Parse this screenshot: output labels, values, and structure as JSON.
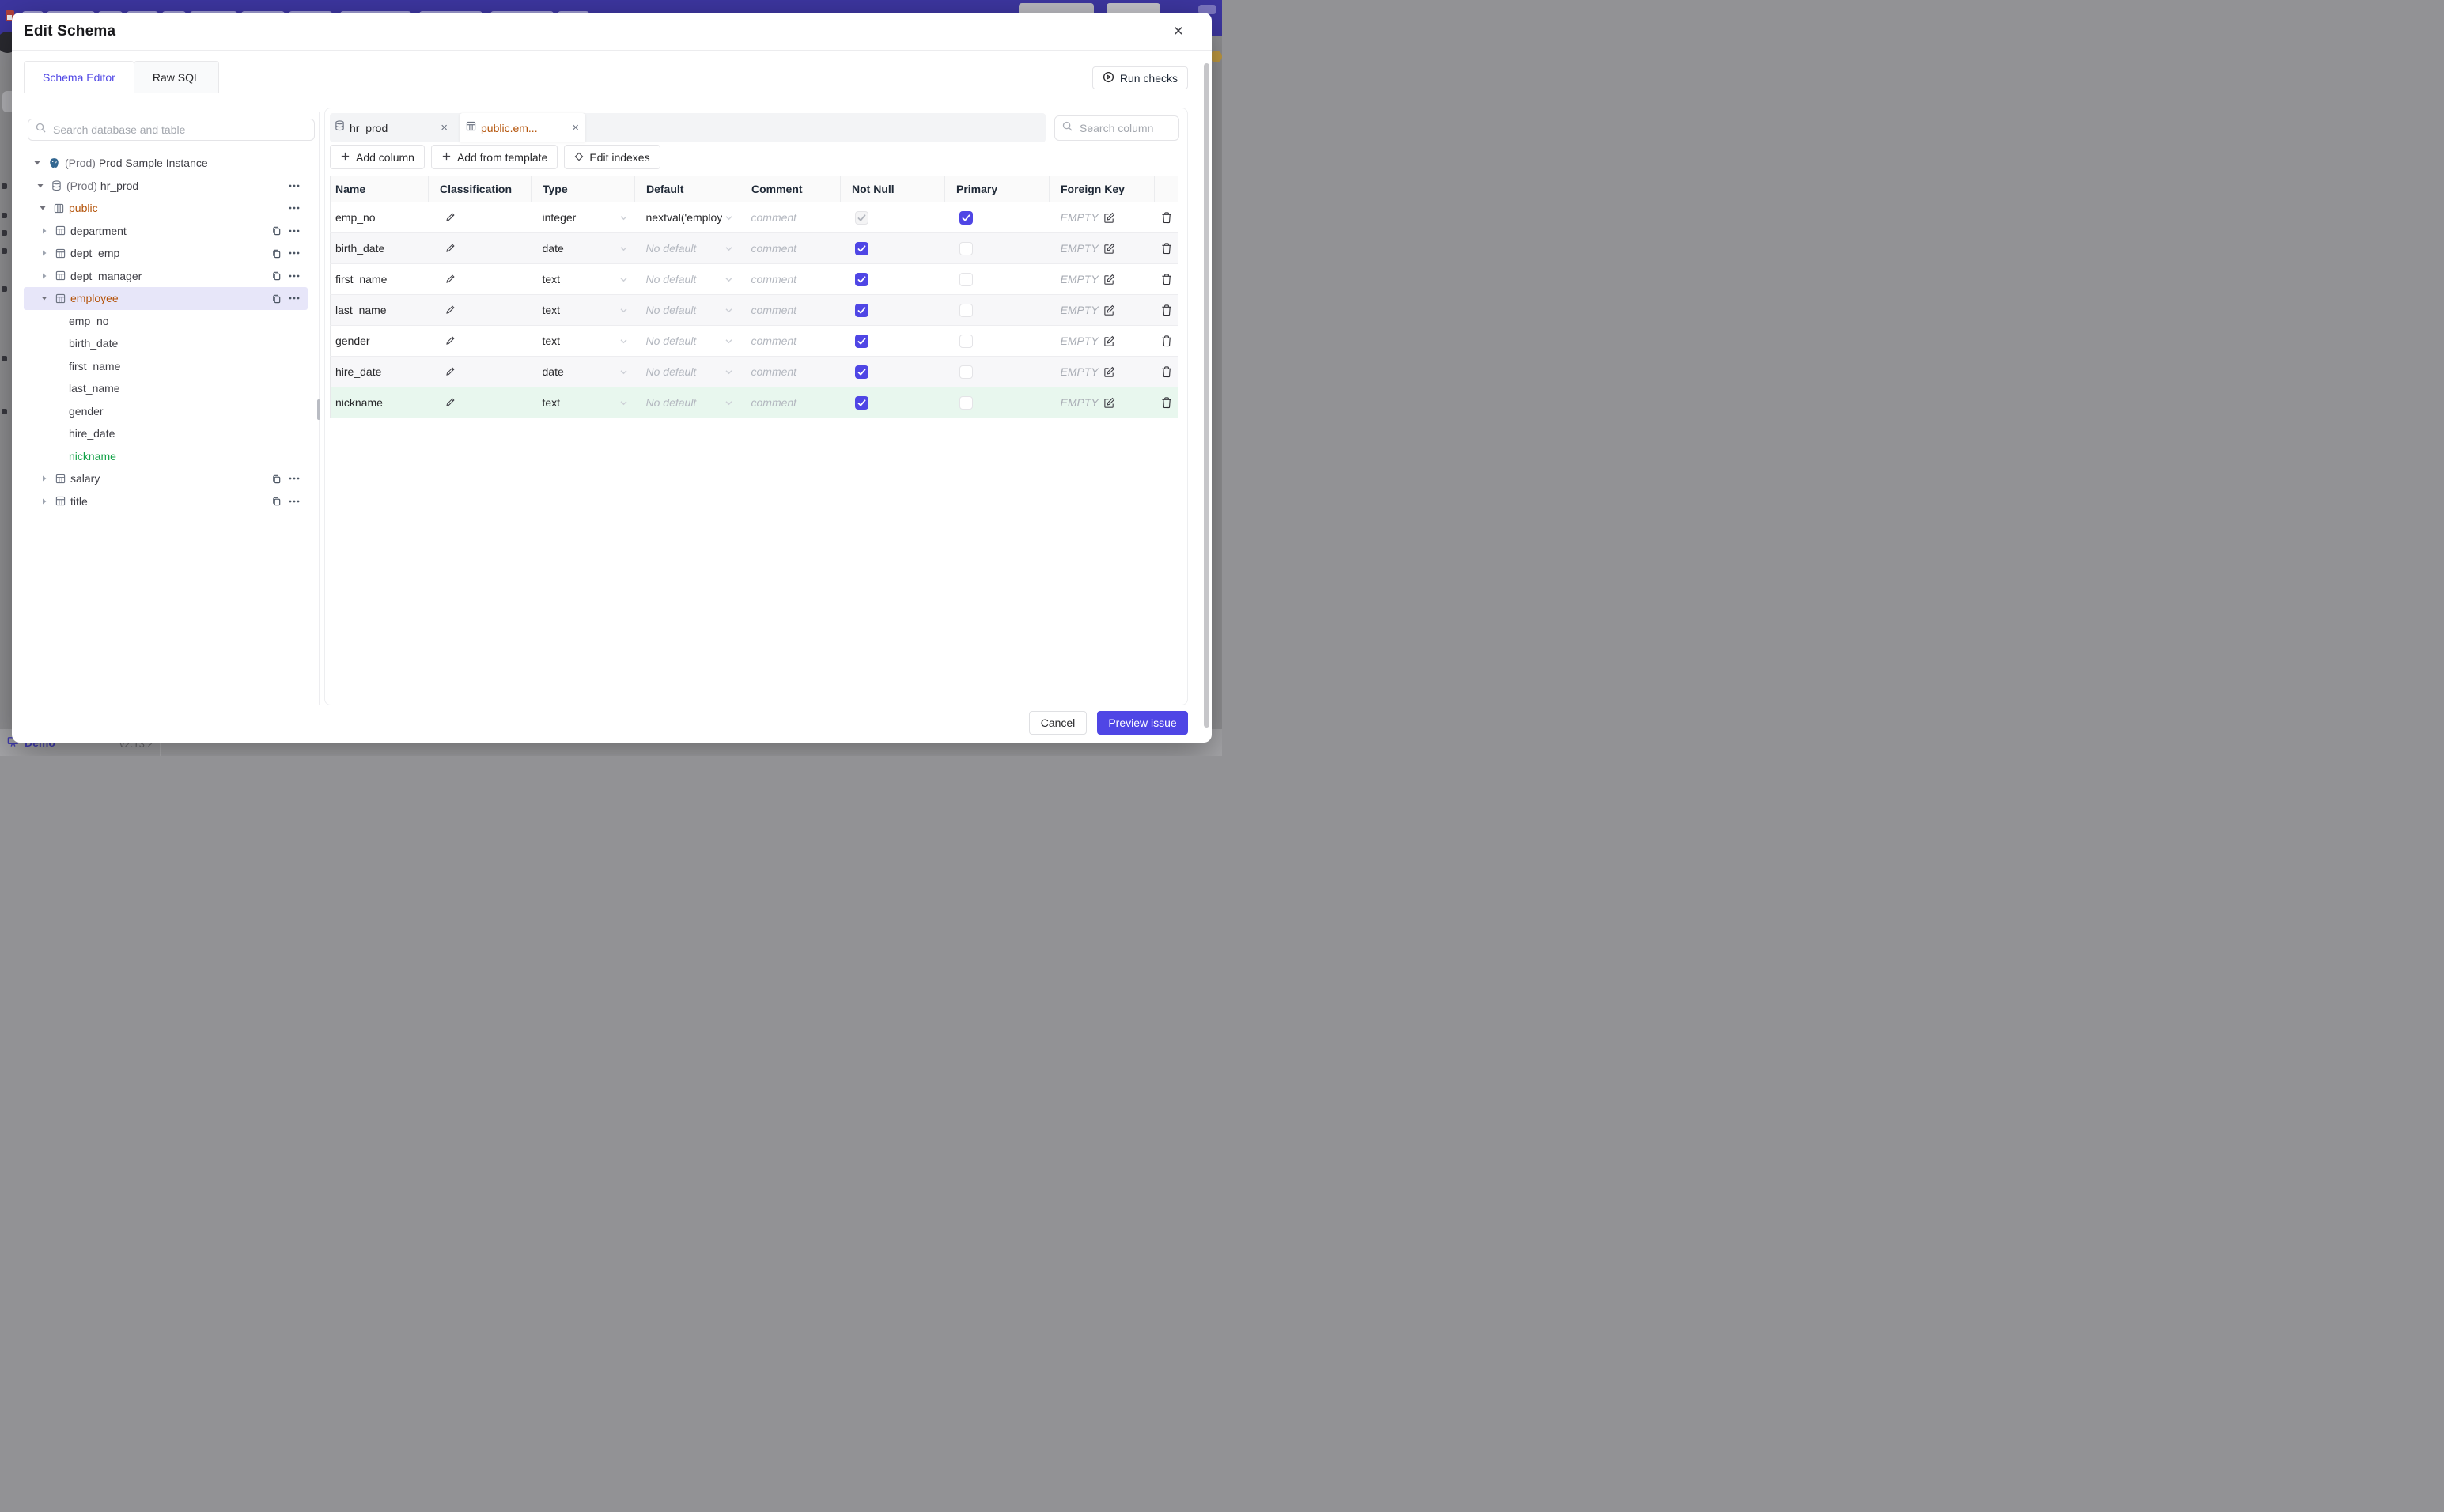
{
  "colors": {
    "accent": "#4f46e5",
    "topbar_purple": "#3d36a0",
    "schema_amber": "#b45309",
    "new_column_green": "#16a34a",
    "selected_row_lavender": "#e7e6f9",
    "new_row_green_bg": "#e8f7ee"
  },
  "backdrop": {
    "demo_label": "Demo",
    "version": "v2.13.2"
  },
  "modal": {
    "title": "Edit Schema",
    "close_icon": "×",
    "nav_tabs": [
      {
        "label": "Schema Editor",
        "active": true
      },
      {
        "label": "Raw SQL",
        "active": false
      }
    ],
    "run_checks_label": "Run checks",
    "sidebar": {
      "search_placeholder": "Search database and table",
      "tree": [
        {
          "level": 0,
          "caret": "down",
          "icon": "postgres",
          "prefix": "(Prod)",
          "label": "Prod Sample Instance",
          "actions": []
        },
        {
          "level": 1,
          "caret": "down",
          "icon": "database",
          "prefix": "(Prod)",
          "label": "hr_prod",
          "actions": [
            "more"
          ]
        },
        {
          "level": 2,
          "caret": "down",
          "icon": "schema",
          "label": "public",
          "style": "amber",
          "actions": [
            "more"
          ]
        },
        {
          "level": 3,
          "caret": "right",
          "icon": "table",
          "label": "department",
          "actions": [
            "copy",
            "more"
          ]
        },
        {
          "level": 3,
          "caret": "right",
          "icon": "table",
          "label": "dept_emp",
          "actions": [
            "copy",
            "more"
          ]
        },
        {
          "level": 3,
          "caret": "right",
          "icon": "table",
          "label": "dept_manager",
          "actions": [
            "copy",
            "more"
          ]
        },
        {
          "level": 3,
          "caret": "down",
          "icon": "table",
          "label": "employee",
          "style": "amber",
          "highlighted": true,
          "actions": [
            "copy",
            "more"
          ]
        },
        {
          "level": "column",
          "label": "emp_no"
        },
        {
          "level": "column",
          "label": "birth_date"
        },
        {
          "level": "column",
          "label": "first_name"
        },
        {
          "level": "column",
          "label": "last_name"
        },
        {
          "level": "column",
          "label": "gender"
        },
        {
          "level": "column",
          "label": "hire_date"
        },
        {
          "level": "column",
          "label": "nickname",
          "style": "green"
        },
        {
          "level": 3,
          "caret": "right",
          "icon": "table",
          "label": "salary",
          "actions": [
            "copy",
            "more"
          ]
        },
        {
          "level": 3,
          "caret": "right",
          "icon": "table",
          "label": "title",
          "actions": [
            "copy",
            "more"
          ]
        }
      ]
    },
    "main": {
      "doc_tabs": [
        {
          "label": "hr_prod",
          "icon": "database",
          "active": false,
          "close_icon": "×"
        },
        {
          "label": "public.em...",
          "icon": "table",
          "active": true,
          "close_icon": "×"
        }
      ],
      "search_placeholder": "Search column",
      "toolbar": [
        {
          "icon": "plus",
          "label": "Add column"
        },
        {
          "icon": "plus",
          "label": "Add from template"
        },
        {
          "icon": "diamond",
          "label": "Edit indexes"
        }
      ],
      "table": {
        "headers": [
          "Name",
          "Classification",
          "Type",
          "Default",
          "Comment",
          "Not Null",
          "Primary",
          "Foreign Key",
          ""
        ],
        "comment_placeholder": "comment",
        "no_default_placeholder": "No default",
        "fk_empty_label": "EMPTY",
        "rows": [
          {
            "name": "emp_no",
            "type": "integer",
            "default": "nextval('employ",
            "default_is_placeholder": false,
            "not_null_checked": true,
            "not_null_disabled": true,
            "primary_checked": true,
            "variant": "plain"
          },
          {
            "name": "birth_date",
            "type": "date",
            "default": "No default",
            "default_is_placeholder": true,
            "not_null_checked": true,
            "not_null_disabled": false,
            "primary_checked": false,
            "variant": "stripe"
          },
          {
            "name": "first_name",
            "type": "text",
            "default": "No default",
            "default_is_placeholder": true,
            "not_null_checked": true,
            "not_null_disabled": false,
            "primary_checked": false,
            "variant": "plain"
          },
          {
            "name": "last_name",
            "type": "text",
            "default": "No default",
            "default_is_placeholder": true,
            "not_null_checked": true,
            "not_null_disabled": false,
            "primary_checked": false,
            "variant": "stripe"
          },
          {
            "name": "gender",
            "type": "text",
            "default": "No default",
            "default_is_placeholder": true,
            "not_null_checked": true,
            "not_null_disabled": false,
            "primary_checked": false,
            "variant": "plain"
          },
          {
            "name": "hire_date",
            "type": "date",
            "default": "No default",
            "default_is_placeholder": true,
            "not_null_checked": true,
            "not_null_disabled": false,
            "primary_checked": false,
            "variant": "stripe"
          },
          {
            "name": "nickname",
            "type": "text",
            "default": "No default",
            "default_is_placeholder": true,
            "not_null_checked": true,
            "not_null_disabled": false,
            "primary_checked": false,
            "variant": "green"
          }
        ]
      }
    },
    "footer": {
      "cancel": "Cancel",
      "primary": "Preview issue"
    }
  }
}
